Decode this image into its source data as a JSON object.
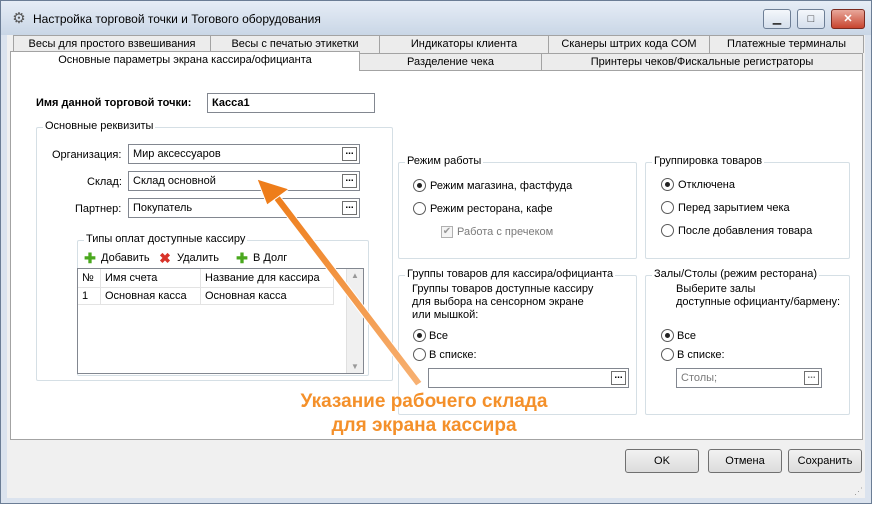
{
  "window": {
    "title": "Настройка торговой точки и Тогового оборудования",
    "min_label": "▁",
    "max_label": "□",
    "close_label": "✕"
  },
  "tabs_row1": [
    "Весы для простого взвешивания",
    "Весы с печатью этикетки",
    "Индикаторы клиента",
    "Сканеры штрих кода COM",
    "Платежные терминалы"
  ],
  "tabs_row2": [
    "Основные параметры экрана кассира/официанта",
    "Разделение чека",
    "Принтеры чеков/Фискальные регистраторы"
  ],
  "main": {
    "point_name_label": "Имя данной торговой точки:",
    "point_name_value": "Касса1",
    "req_group": "Основные реквизиты",
    "org_label": "Организация:",
    "org_value": "Мир аксессуаров",
    "warehouse_label": "Склад:",
    "warehouse_value": "Склад основной",
    "partner_label": "Партнер:",
    "partner_value": "Покупатель",
    "dots": "...",
    "payments_group": "Типы оплат доступные кассиру",
    "add_label": "Добавить",
    "delete_label": "Удалить",
    "credit_label": "В Долг",
    "columns": [
      "№",
      "Имя счета",
      "Название для кассира"
    ],
    "rows": [
      [
        "1",
        "Основная касса",
        "Основная касса"
      ]
    ],
    "scroll_up": "▲",
    "scroll_down": "▼"
  },
  "mode": {
    "group": "Режим работы",
    "shop": "Режим магазина, фастфуда",
    "restaurant": "Режим ресторана, кафе",
    "receipt": "Работа с пречеком",
    "selected": "shop",
    "receipt_checked": true
  },
  "grouping": {
    "group": "Группировка товаров",
    "off": "Отключена",
    "before_close": "Перед зарытием чека",
    "after_add": "После добавления товара",
    "selected": "off"
  },
  "product_groups": {
    "group": "Группы товаров для кассира/официанта",
    "desc1": "Группы товаров доступные кассиру",
    "desc2": "для выбора на сенсорном экране",
    "desc3": "или мышкой:",
    "all": "Все",
    "list": "В списке:",
    "selected": "all",
    "value": ""
  },
  "halls": {
    "group": "Залы/Столы (режим ресторана)",
    "desc1": "Выберите залы",
    "desc2": "доступные официанту/бармену:",
    "all": "Все",
    "list": "В списке:",
    "selected": "all",
    "value": "Столы;"
  },
  "buttons": {
    "ok": "OK",
    "cancel": "Отмена",
    "save": "Сохранить"
  },
  "annotation": {
    "line1": "Указание рабочего склада",
    "line2": "для экрана кассира",
    "color": "#f4902a"
  }
}
